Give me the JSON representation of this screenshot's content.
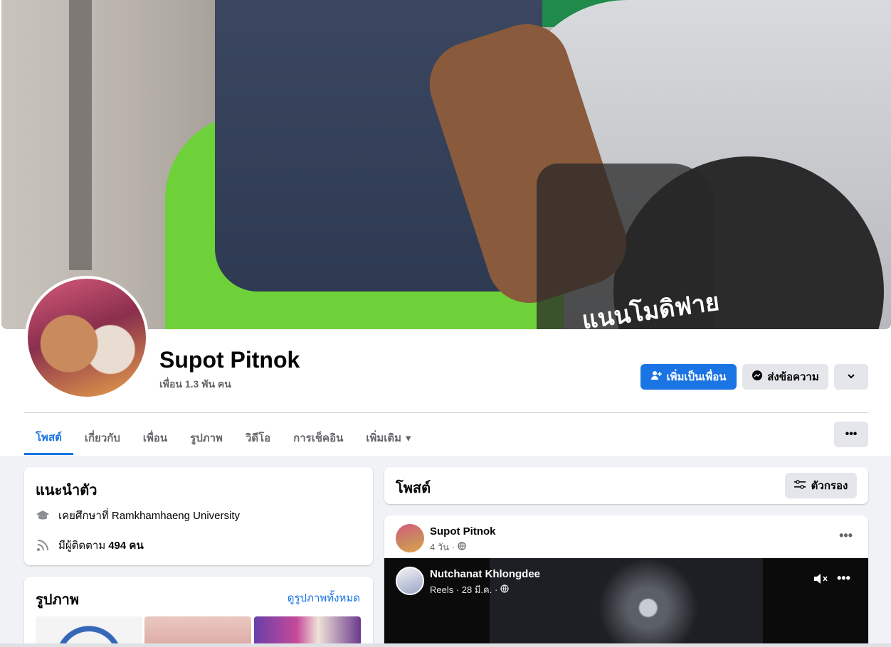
{
  "profile": {
    "name": "Supot Pitnok",
    "friends": "เพื่อน 1.3 พัน คน",
    "cover_text": "แนนโมดิฟาย"
  },
  "actions": {
    "add_friend": "เพิ่มเป็นเพื่อน",
    "message": "ส่งข้อความ",
    "caret_icon": "chevron-down-icon"
  },
  "tabs": [
    {
      "label": "โพสต์",
      "active": true
    },
    {
      "label": "เกี่ยวกับ"
    },
    {
      "label": "เพื่อน"
    },
    {
      "label": "รูปภาพ"
    },
    {
      "label": "วิดีโอ"
    },
    {
      "label": "การเช็คอิน"
    },
    {
      "label": "เพิ่มเติม"
    }
  ],
  "intro": {
    "title": "แนะนำตัว",
    "studied": "เคยศึกษาที่ Ramkhamhaeng University",
    "followers_prefix": "มีผู้ติดตาม",
    "followers_count": "494 คน"
  },
  "photos": {
    "title": "รูปภาพ",
    "see_all": "ดูรูปภาพทั้งหมด"
  },
  "posts": {
    "title": "โพสต์",
    "filter": "ตัวกรอง"
  },
  "post": {
    "author": "Supot Pitnok",
    "meta": "4 วัน ·",
    "reel_author": "Nutchanat Khlongdee",
    "reel_meta": "Reels · 28 มี.ค. ·"
  },
  "colors": {
    "accent": "#1b74e4",
    "page_bg": "#f0f2f5"
  }
}
